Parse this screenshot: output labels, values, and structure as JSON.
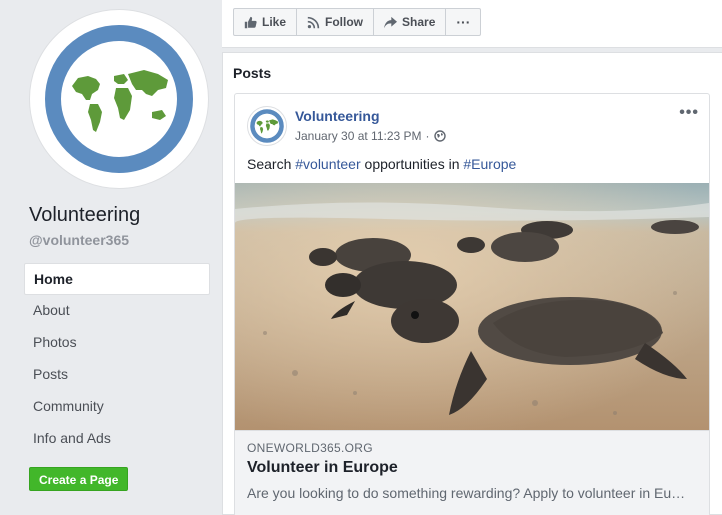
{
  "page": {
    "name": "Volunteering",
    "handle": "@volunteer365"
  },
  "nav": {
    "items": [
      {
        "label": "Home",
        "active": true
      },
      {
        "label": "About"
      },
      {
        "label": "Photos"
      },
      {
        "label": "Posts"
      },
      {
        "label": "Community"
      },
      {
        "label": "Info and Ads"
      }
    ],
    "create_page": "Create a Page"
  },
  "actions": {
    "like": "Like",
    "follow": "Follow",
    "share": "Share",
    "more": "···"
  },
  "posts": {
    "heading": "Posts",
    "post": {
      "author": "Volunteering",
      "timestamp": "January 30 at 11:23 PM",
      "separator": "·",
      "text_parts": [
        "Search ",
        "#volunteer",
        " opportunities in ",
        "#Europe"
      ],
      "more": "•••",
      "link": {
        "domain": "ONEWORLD365.ORG",
        "title": "Volunteer in Europe",
        "description": "Are you looking to do something rewarding? Apply to volunteer in Europe with a project of your choice."
      }
    }
  },
  "colors": {
    "accent": "#365899",
    "create_button": "#42b72a",
    "logo_ring": "#5b8bbf",
    "logo_land": "#5e9a3a"
  },
  "icons": [
    "globe-logo",
    "thumbs-up-icon",
    "rss-icon",
    "share-arrow-icon",
    "globe-privacy-icon"
  ]
}
